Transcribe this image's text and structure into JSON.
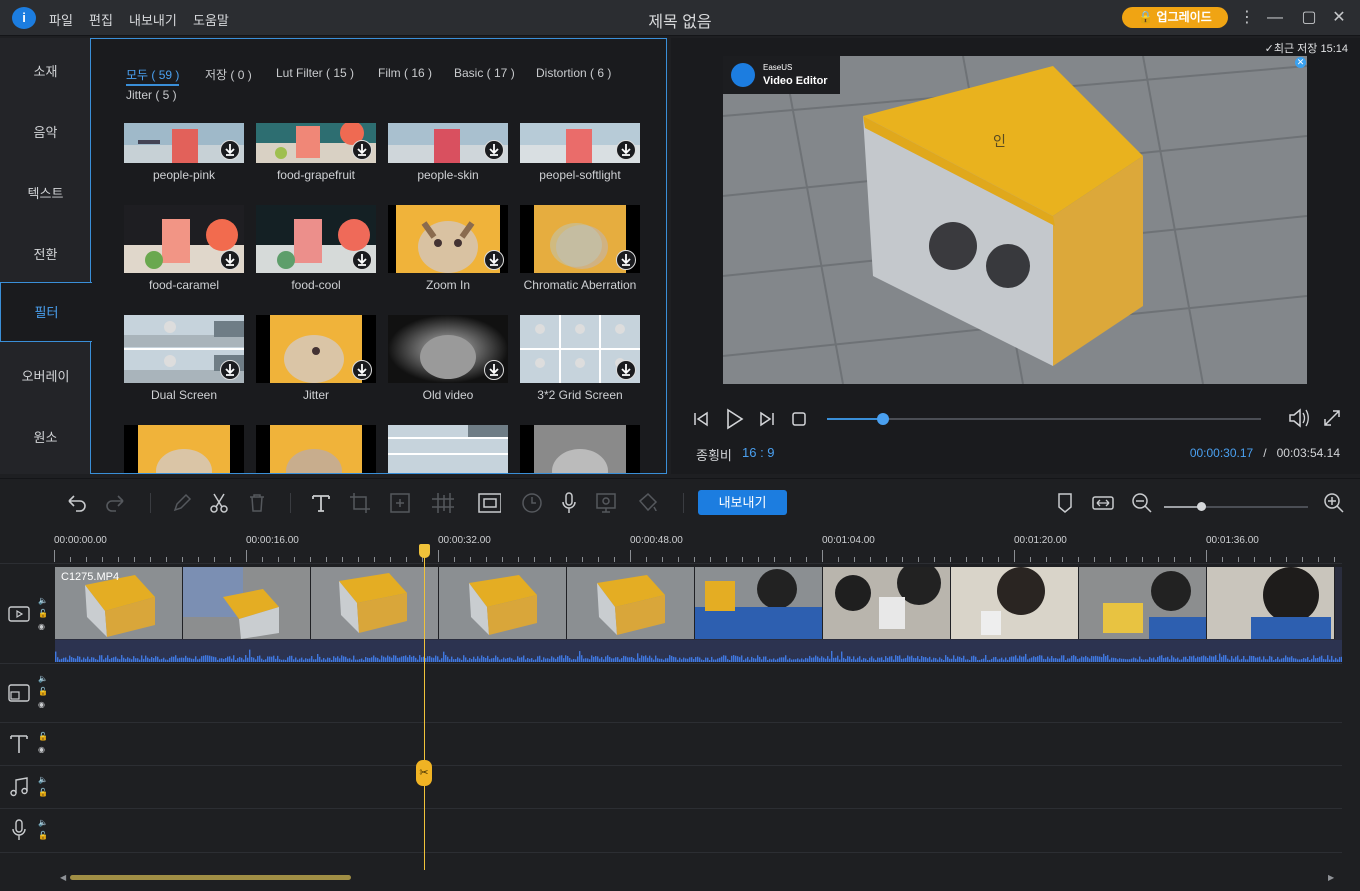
{
  "app": {
    "title": "제목 없음",
    "menu": [
      "파일",
      "편집",
      "내보내기",
      "도움말"
    ],
    "upgrade_label": "업그레이드",
    "logo_glyph": "i",
    "brand_color": "#1c7de0",
    "accent_color": "#3a8fd8"
  },
  "sidebar": {
    "items": [
      {
        "label": "소재"
      },
      {
        "label": "음악"
      },
      {
        "label": "텍스트"
      },
      {
        "label": "전환"
      },
      {
        "label": "필터",
        "active": true
      },
      {
        "label": "오버레이"
      },
      {
        "label": "원소"
      }
    ]
  },
  "filters": {
    "tabs": [
      "모두 ( 59 )",
      "저장 ( 0 )",
      "Lut Filter ( 15 )",
      "Film ( 16 )",
      "Basic ( 17 )",
      "Distortion ( 6 )",
      "Jitter ( 5 )"
    ],
    "items": [
      {
        "label": "people-pink"
      },
      {
        "label": "food-grapefruit"
      },
      {
        "label": "people-skin"
      },
      {
        "label": "peopel-softlight"
      },
      {
        "label": "food-caramel"
      },
      {
        "label": "food-cool"
      },
      {
        "label": "Zoom In"
      },
      {
        "label": "Chromatic Aberration"
      },
      {
        "label": "Dual Screen"
      },
      {
        "label": "Jitter"
      },
      {
        "label": "Old video"
      },
      {
        "label": "3*2 Grid Screen"
      }
    ]
  },
  "preview": {
    "last_saved": "최근 저장 15:14",
    "watermark_brand": "EaseUS",
    "watermark_product": "Video Editor",
    "aspect_label": "종횡비",
    "aspect_value": "16 : 9",
    "current_time": "00:00:30.17",
    "separator": "/",
    "total_time": "00:03:54.14",
    "progress": 0.13
  },
  "toolbar": {
    "export_label": "내보내기",
    "zoom_level": 0.26
  },
  "timeline": {
    "ruler": [
      "00:00:00.00",
      "00:00:16.00",
      "00:00:32.00",
      "00:00:48.00",
      "00:01:04.00",
      "00:01:20.00",
      "00:01:36.00"
    ],
    "clip_name": "C1275.MP4",
    "playhead_time": "00:00:30.17"
  }
}
